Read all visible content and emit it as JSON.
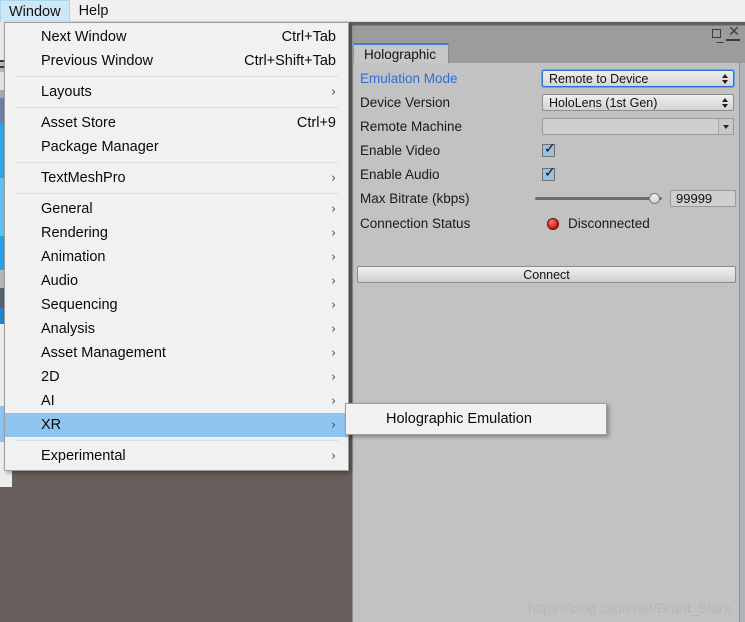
{
  "menubar": {
    "items": [
      {
        "label": "Window",
        "active": true
      },
      {
        "label": "Help",
        "active": false
      }
    ]
  },
  "window_menu": {
    "groups": [
      {
        "items": [
          {
            "label": "Next Window",
            "shortcut": "Ctrl+Tab",
            "arrow": ""
          },
          {
            "label": "Previous Window",
            "shortcut": "Ctrl+Shift+Tab",
            "arrow": ""
          }
        ]
      },
      {
        "items": [
          {
            "label": "Layouts",
            "shortcut": "",
            "arrow": "›"
          }
        ]
      },
      {
        "items": [
          {
            "label": "Asset Store",
            "shortcut": "Ctrl+9",
            "arrow": ""
          },
          {
            "label": "Package Manager",
            "shortcut": "",
            "arrow": ""
          }
        ]
      },
      {
        "items": [
          {
            "label": "TextMeshPro",
            "shortcut": "",
            "arrow": "›"
          }
        ]
      },
      {
        "items": [
          {
            "label": "General",
            "shortcut": "",
            "arrow": "›"
          },
          {
            "label": "Rendering",
            "shortcut": "",
            "arrow": "›"
          },
          {
            "label": "Animation",
            "shortcut": "",
            "arrow": "›"
          },
          {
            "label": "Audio",
            "shortcut": "",
            "arrow": "›"
          },
          {
            "label": "Sequencing",
            "shortcut": "",
            "arrow": "›"
          },
          {
            "label": "Analysis",
            "shortcut": "",
            "arrow": "›"
          },
          {
            "label": "Asset Management",
            "shortcut": "",
            "arrow": "›"
          },
          {
            "label": "2D",
            "shortcut": "",
            "arrow": "›"
          },
          {
            "label": "AI",
            "shortcut": "",
            "arrow": "›"
          },
          {
            "label": "XR",
            "shortcut": "",
            "arrow": "›",
            "highlight": true
          }
        ]
      },
      {
        "items": [
          {
            "label": "Experimental",
            "shortcut": "",
            "arrow": "›"
          }
        ]
      }
    ]
  },
  "submenu": {
    "items": [
      {
        "label": "Holographic Emulation",
        "shortcut": "",
        "arrow": ""
      }
    ]
  },
  "editor_window": {
    "tab_label": "Holographic",
    "title_buttons": {
      "maximize": "maximize-icon",
      "close": "✕",
      "menu": "window-menu-icon"
    },
    "rows": [
      {
        "label": "Emulation Mode",
        "label_is_link": true,
        "control": "dropdown",
        "value": "Remote to Device",
        "focused": true
      },
      {
        "label": "Device Version",
        "label_is_link": false,
        "control": "dropdown",
        "value": "HoloLens (1st Gen)",
        "focused": false
      },
      {
        "label": "Remote Machine",
        "label_is_link": false,
        "control": "combo",
        "value": ""
      },
      {
        "label": "Enable Video",
        "label_is_link": false,
        "control": "checkbox",
        "checked": true
      },
      {
        "label": "Enable Audio",
        "label_is_link": false,
        "control": "checkbox",
        "checked": true
      },
      {
        "label": "Max Bitrate (kbps)",
        "label_is_link": false,
        "control": "slider",
        "value": "99999",
        "knob_percent": 90
      },
      {
        "label": "Connection Status",
        "label_is_link": false,
        "control": "status",
        "value": "Disconnected",
        "status_color": "#c21a12"
      }
    ],
    "connect_button": "Connect"
  },
  "watermark": "https://blog.csdn.net/Brant_Stark",
  "colors": {
    "desktop": "#675f5b",
    "menu_bg": "#f1f1f1",
    "menu_highlight": "#8fc4f0",
    "menubar_active": "#cce8f7",
    "panel_bg": "#c2c2c2",
    "panel_chrome": "#9c9c9c",
    "tab_accent": "#3b7fd4",
    "link_blue": "#2d6fd5"
  }
}
